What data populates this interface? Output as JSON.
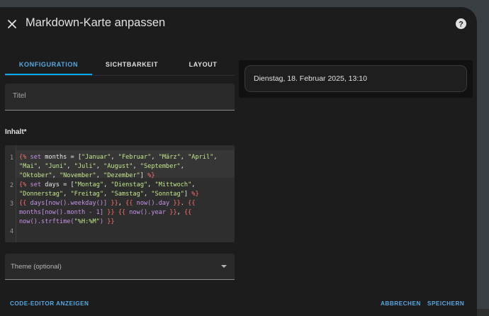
{
  "dialog": {
    "title": "Markdown-Karte anpassen",
    "close_icon": "close-icon",
    "help_icon": "help-circle-icon"
  },
  "tabs": [
    {
      "label": "KONFIGURATION",
      "active": true
    },
    {
      "label": "SICHTBARKEIT",
      "active": false
    },
    {
      "label": "LAYOUT",
      "active": false
    }
  ],
  "form": {
    "title_placeholder": "Titel",
    "content_label": "Inhalt*",
    "theme_label": "Theme (optional)"
  },
  "editor": {
    "line_numbers": [
      "1",
      "2",
      "3",
      "4"
    ],
    "lines": [
      "{% set months = [\"Januar\", \"Februar\", \"März\", \"April\", \"Mai\", \"Juni\", \"Juli\", \"August\", \"September\", \"Oktober\", \"November\", \"Dezember\"] %}",
      "{% set days = [\"Montag\", \"Dienstag\", \"Mittwoch\", \"Donnerstag\", \"Freitag\", \"Samstag\", \"Sonntag\"] %}",
      "{{ days[now().weekday()] }}, {{ now().day }}. {{ months[now().month - 1] }} {{ now().year }}, {{ now().strftime(\"%H:%M\") }}",
      ""
    ]
  },
  "footer": {
    "code_editor_label": "CODE-EDITOR ANZEIGEN",
    "cancel_label": "ABBRECHEN",
    "save_label": "SPEICHERN"
  },
  "preview": {
    "text": "Dienstag, 18. Februar 2025, 13:10"
  },
  "colors": {
    "accent": "#03a9f4",
    "dialog_bg": "#1c1c1c",
    "field_bg": "#2a2a2a",
    "template_tag": "#ff6b6b",
    "string": "#c3e88d",
    "variable": "#c792ea"
  }
}
